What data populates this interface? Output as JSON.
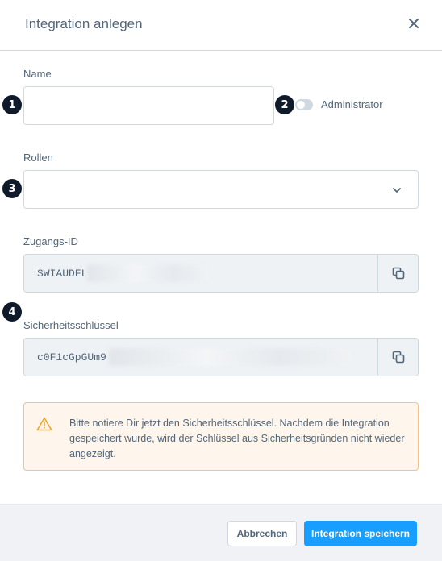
{
  "modal": {
    "title": "Integration anlegen",
    "close_icon": "close-icon"
  },
  "markers": [
    "1",
    "2",
    "3",
    "4"
  ],
  "form": {
    "name_label": "Name",
    "name_value": "",
    "admin_label": "Administrator",
    "admin_enabled": false,
    "roles_label": "Rollen",
    "roles_value": "",
    "access_id_label": "Zugangs-ID",
    "access_id_value": "SWIAUDFL",
    "secret_label": "Sicherheitsschlüssel",
    "secret_value": "c0F1cGpGUm9"
  },
  "alert": {
    "icon": "warning-icon",
    "text": "Bitte notiere Dir jetzt den Sicherheitsschlüssel. Nachdem die Integration gespeichert wurde, wird der Schlüssel aus Sicherheitsgründen nicht wieder angezeigt."
  },
  "footer": {
    "cancel_label": "Abbrechen",
    "save_label": "Integration speichern"
  },
  "colors": {
    "primary": "#189eff",
    "text": "#52667a",
    "marker": "#0f1b2a",
    "warning_border": "#f2c38a",
    "warning_bg": "#fef6ec",
    "warning_icon": "#f0a52f"
  }
}
